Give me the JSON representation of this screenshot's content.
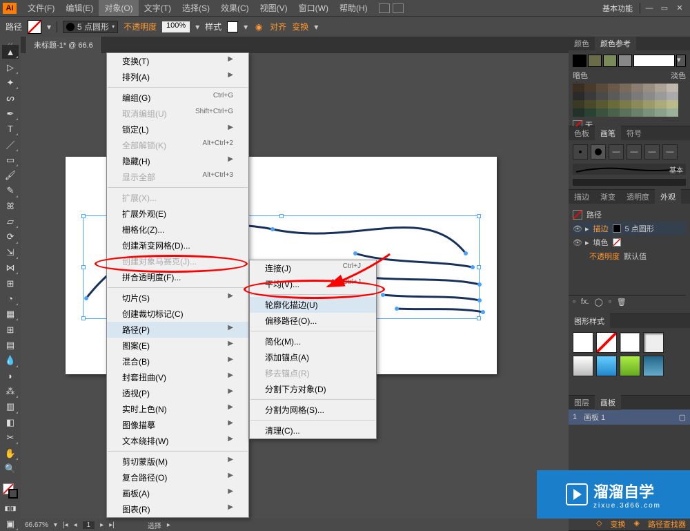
{
  "app": {
    "logo": "Ai",
    "workspace": "基本功能"
  },
  "menubar": [
    "文件(F)",
    "编辑(E)",
    "对象(O)",
    "文字(T)",
    "选择(S)",
    "效果(C)",
    "视图(V)",
    "窗口(W)",
    "帮助(H)"
  ],
  "active_menu_index": 2,
  "toolbar": {
    "label": "路径",
    "stroke_label": "5 点圆形",
    "opacity_label": "不透明度",
    "opacity_val": "100%",
    "style_label": "样式",
    "align": "对齐",
    "transform": "变换"
  },
  "doc_tab": "未标题-1* @ 66.6",
  "menu1": [
    {
      "t": "变换(T)",
      "sub": true
    },
    {
      "t": "排列(A)",
      "sub": true
    },
    "-",
    {
      "t": "编组(G)",
      "k": "Ctrl+G"
    },
    {
      "t": "取消编组(U)",
      "k": "Shift+Ctrl+G",
      "d": true
    },
    {
      "t": "锁定(L)",
      "sub": true
    },
    {
      "t": "全部解锁(K)",
      "k": "Alt+Ctrl+2",
      "d": true
    },
    {
      "t": "隐藏(H)",
      "sub": true
    },
    {
      "t": "显示全部",
      "k": "Alt+Ctrl+3",
      "d": true
    },
    "-",
    {
      "t": "扩展(X)...",
      "d": true
    },
    {
      "t": "扩展外观(E)"
    },
    {
      "t": "栅格化(Z)..."
    },
    {
      "t": "创建渐变网格(D)..."
    },
    {
      "t": "创建对象马赛克(J)...",
      "d": true
    },
    {
      "t": "拼合透明度(F)..."
    },
    "-",
    {
      "t": "切片(S)",
      "sub": true
    },
    {
      "t": "创建裁切标记(C)"
    },
    {
      "t": "路径(P)",
      "sub": true,
      "hl": true
    },
    {
      "t": "图案(E)",
      "sub": true
    },
    {
      "t": "混合(B)",
      "sub": true
    },
    {
      "t": "封套扭曲(V)",
      "sub": true
    },
    {
      "t": "透视(P)",
      "sub": true
    },
    {
      "t": "实时上色(N)",
      "sub": true
    },
    {
      "t": "图像描摹",
      "sub": true
    },
    {
      "t": "文本绕排(W)",
      "sub": true
    },
    "-",
    {
      "t": "剪切蒙版(M)",
      "sub": true
    },
    {
      "t": "复合路径(O)",
      "sub": true
    },
    {
      "t": "画板(A)",
      "sub": true
    },
    {
      "t": "图表(R)",
      "sub": true
    }
  ],
  "menu2": [
    {
      "t": "连接(J)",
      "k": "Ctrl+J"
    },
    {
      "t": "平均(V)...",
      "k": "Alt+Ctrl+J"
    },
    "-",
    {
      "t": "轮廓化描边(U)",
      "hl": true
    },
    {
      "t": "偏移路径(O)..."
    },
    "-",
    {
      "t": "简化(M)..."
    },
    {
      "t": "添加锚点(A)"
    },
    {
      "t": "移去锚点(R)",
      "d": true
    },
    {
      "t": "分割下方对象(D)"
    },
    "-",
    {
      "t": "分割为网格(S)..."
    },
    "-",
    {
      "t": "清理(C)..."
    }
  ],
  "panels": {
    "colorTabs": [
      "颜色",
      "颜色参考"
    ],
    "dark": "暗色",
    "light": "淡色",
    "none": "无",
    "colorTabs2": [
      "色板",
      "画笔",
      "符号"
    ],
    "basic": "基本",
    "appearTabs": [
      "描边",
      "渐变",
      "透明度",
      "外观"
    ],
    "pathLabel": "路径",
    "strokeLabel": "描边",
    "strokeStyle": "5 点圆形",
    "fillLabel": "填色",
    "opacityLabel": "不透明度",
    "opacityVal": "默认值",
    "stylesTab": "图形样式",
    "layersTabs": [
      "图层",
      "画板"
    ],
    "artboard": "画板 1"
  },
  "status": {
    "zoom": "66.67%",
    "sel": "选择"
  },
  "footer": {
    "transform": "变换",
    "pathfinder": "路径查找器"
  },
  "watermark": {
    "big": "溜溜自学",
    "small": "zixue.3d66.com"
  }
}
